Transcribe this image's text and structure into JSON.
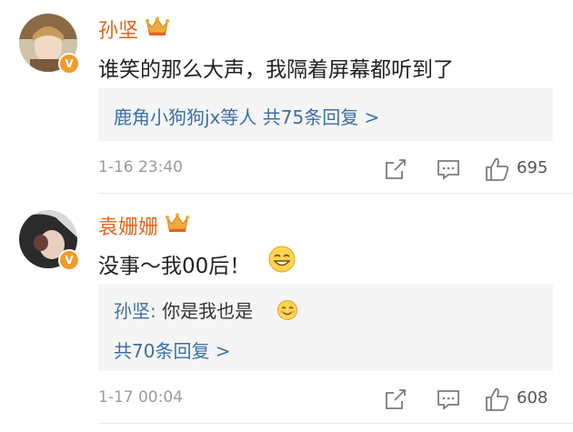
{
  "comments": [
    {
      "username": "孙坚",
      "text": "谁笑的那么大声，我隔着屏幕都听到了",
      "replies_summary": "鹿角小狗狗jx等人 共75条回复 >",
      "time": "1-16 23:40",
      "likes": "695",
      "verified_badge": "V"
    },
    {
      "username": "袁姗姗",
      "text": "没事～我00后！",
      "reply": {
        "name": "孙坚:",
        "text": " 你是我也是"
      },
      "replies_summary": "共70条回复 >",
      "time": "1-17 00:04",
      "likes": "608",
      "verified_badge": "V"
    }
  ],
  "colors": {
    "username": "#e5631d",
    "link": "#3a6fa8",
    "badge": "#f39a2a"
  },
  "icons": [
    "crown-icon",
    "share-icon",
    "comment-icon",
    "thumbs-up-icon",
    "grin-emoji",
    "smile-emoji"
  ]
}
